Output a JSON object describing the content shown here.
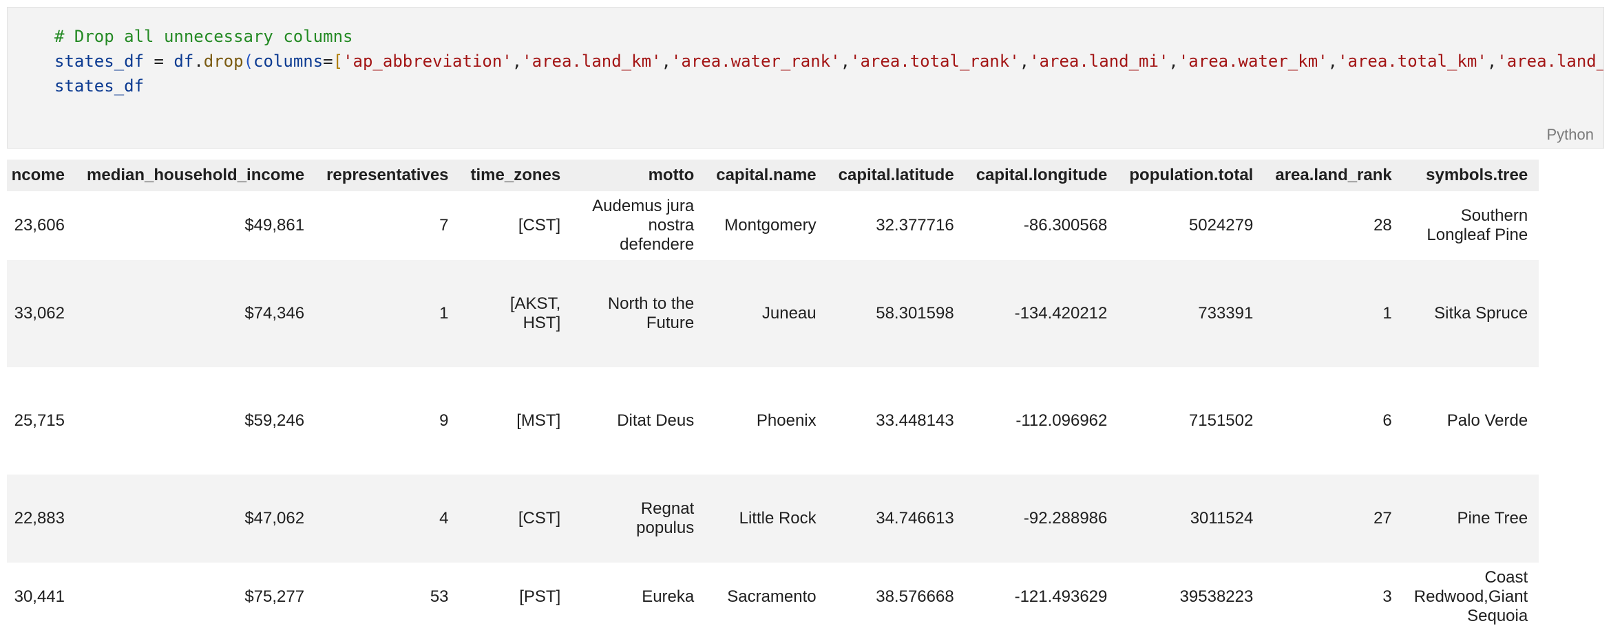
{
  "code": {
    "comment": "# Drop all unnecessary columns",
    "line2": {
      "var": "states_df",
      "eq": " = ",
      "obj": "df",
      "dot": ".",
      "func": "drop",
      "open": "(",
      "kw": "columns",
      "kw_eq": "=",
      "lbrack": "[",
      "strings": [
        "'ap_abbreviation'",
        "'area.land_km'",
        "'area.water_rank'",
        "'area.total_rank'",
        "'area.land_mi'",
        "'area.water_km'",
        "'area.total_km'",
        "'area.land_"
      ],
      "comma": ","
    },
    "line3": "states_df",
    "language": "Python"
  },
  "table": {
    "columns": [
      "ncome",
      "median_household_income",
      "representatives",
      "time_zones",
      "motto",
      "capital.name",
      "capital.latitude",
      "capital.longitude",
      "population.total",
      "area.land_rank",
      "symbols.tree"
    ],
    "rows": [
      [
        "23,606",
        "$49,861",
        "7",
        "[CST]",
        "Audemus jura nostra defendere",
        "Montgomery",
        "32.377716",
        "-86.300568",
        "5024279",
        "28",
        "Southern Longleaf Pine"
      ],
      [
        "33,062",
        "$74,346",
        "1",
        "[AKST, HST]",
        "North to the Future",
        "Juneau",
        "58.301598",
        "-134.420212",
        "733391",
        "1",
        "Sitka Spruce"
      ],
      [
        "25,715",
        "$59,246",
        "9",
        "[MST]",
        "Ditat Deus",
        "Phoenix",
        "33.448143",
        "-112.096962",
        "7151502",
        "6",
        "Palo Verde"
      ],
      [
        "22,883",
        "$47,062",
        "4",
        "[CST]",
        "Regnat populus",
        "Little Rock",
        "34.746613",
        "-92.288986",
        "3011524",
        "27",
        "Pine Tree"
      ],
      [
        "30,441",
        "$75,277",
        "53",
        "[PST]",
        "Eureka",
        "Sacramento",
        "38.576668",
        "-121.493629",
        "39538223",
        "3",
        "Coast Redwood,Giant Sequoia"
      ]
    ]
  }
}
